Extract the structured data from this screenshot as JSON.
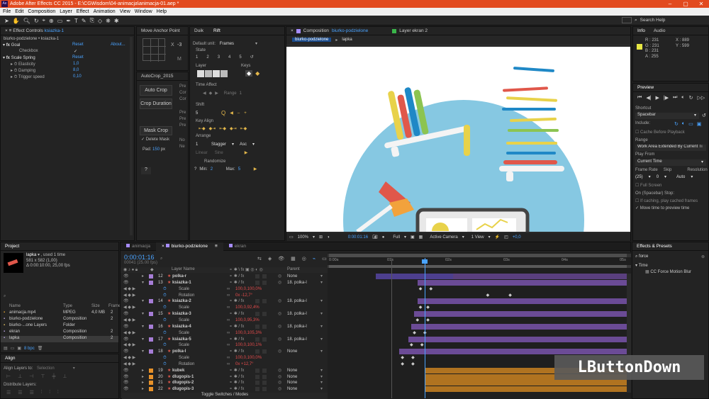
{
  "app": {
    "title": "Adobe After Effects CC 2015 - E:\\CGWisdom\\04-animacja\\animacja-01.aep *",
    "logo": "Ae"
  },
  "menu": [
    "File",
    "Edit",
    "Composition",
    "Layer",
    "Effect",
    "Animation",
    "View",
    "Window",
    "Help"
  ],
  "search_help": "Search Help",
  "effect_controls": {
    "tab": "Effect Controls",
    "target": "ksiazka-1",
    "breadcrumb": "biurko-podzielone • ksiazka-1",
    "goal": "Goal",
    "reset": "Reset",
    "about": "About...",
    "checkbox": "Checkbox",
    "scale_spring": "Scale Spring",
    "reset2": "Reset",
    "elasticity": "Elasticity",
    "elasticity_val": "1,0",
    "damping": "Damping",
    "damping_val": "8,0",
    "trigger": "Trigger speed",
    "trigger_val": "0,10"
  },
  "anchor_panel": {
    "title": "Move Anchor Point",
    "x": "X",
    "x_val": "-3",
    "m": "M"
  },
  "autocrop": {
    "title": "AutoCrop_2015",
    "auto_crop": "Auto Crop",
    "crop_duration": "Crop Duration",
    "mask_crop": "Mask Crop",
    "delete_mask": "Delete Mask",
    "pad_label": "Pad:",
    "pad_val": "150",
    "pad_unit": "px",
    "help": "?",
    "side_labels": [
      "Pre",
      "Cor",
      "Cor",
      "Pre",
      "Pre",
      "Pre",
      "No",
      "Ne"
    ]
  },
  "rift": {
    "tabs": [
      "Duik",
      "Rift"
    ],
    "default_unit_label": "Default unit:",
    "default_unit": "Frames",
    "state": "State",
    "state_nums": [
      "1",
      "2",
      "3",
      "4",
      "5"
    ],
    "layer": "Layer",
    "keys": "Keys",
    "time_affect": "Time Affect",
    "range_label": "Range",
    "range_val": "1",
    "shift": "Shift",
    "shift_val": "5",
    "key_align": "Key Align",
    "arrange": "Arrange",
    "arrange_val": "1",
    "stagger": "Stagger",
    "asc": "Asc",
    "linear": "Linear",
    "sine": "Sine",
    "randomize": "Randomize",
    "min_label": "Min:",
    "min_val": "2",
    "max_label": "Max:",
    "max_val": "5",
    "help": "?"
  },
  "composition": {
    "tab_prefix": "Composition",
    "tab_name": "biurko-podzielone",
    "layer_tab": "Layer ekran 2",
    "sub_tabs": [
      "biurko-podzielone",
      "lapka"
    ],
    "zoom": "100%",
    "time": "0:00:01:16",
    "resolution": "Full",
    "camera": "Active Camera",
    "view": "1 View",
    "exposure": "+0,0"
  },
  "info": {
    "tabs": [
      "Info",
      "Audio"
    ],
    "r": "R : 231",
    "g": "G : 231",
    "b": "B : 231",
    "a": "A : 255",
    "x": "X : 889",
    "y": "Y : 599",
    "swatch_color": "#e7e743"
  },
  "preview": {
    "title": "Preview",
    "shortcut_label": "Shortcut",
    "shortcut": "Spacebar",
    "include": "Include:",
    "cache_before": "Cache Before Playback",
    "range_label": "Range",
    "range": "Work Area Extended By Current Ti",
    "play_from_label": "Play From",
    "play_from": "Current Time",
    "frame_rate_label": "Frame Rate",
    "skip_label": "Skip",
    "res_label": "Resolution",
    "frame_rate": "(25)",
    "skip": "0",
    "res": "Auto",
    "full_screen": "Full Screen",
    "on_stop": "On (Spacebar) Stop:",
    "if_caching": "If caching, play cached frames",
    "move_time": "Move time to preview time"
  },
  "effects_presets": {
    "title": "Effects & Presets",
    "search": "force",
    "group": "Time",
    "item": "CC Force Motion Blur"
  },
  "project": {
    "title": "Project",
    "item_name": "lapka",
    "used": ", used 1 time",
    "dims": "581 x 582 (1,00)",
    "duration": "Δ 0:00:10:00, 25,00 fps",
    "columns": [
      "Name",
      "Type",
      "Size",
      "Frame"
    ],
    "rows": [
      {
        "name": "animacja.mp4",
        "type": "MPEG",
        "size": "4,0 MB",
        "fr": "2",
        "color": "#e0a030"
      },
      {
        "name": "biurko-podzielone",
        "type": "Composition",
        "size": "",
        "fr": "2",
        "color": "#b9a4e0"
      },
      {
        "name": "biurko-...one Layers",
        "type": "Folder",
        "size": "",
        "fr": "",
        "color": "#e0c060"
      },
      {
        "name": "ekran",
        "type": "Composition",
        "size": "",
        "fr": "2",
        "color": "#b9a4e0"
      },
      {
        "name": "lapka",
        "type": "Composition",
        "size": "",
        "fr": "2",
        "color": "#b9a4e0"
      }
    ],
    "bpc": "8 bpc"
  },
  "align": {
    "title": "Align",
    "align_to_label": "Align Layers to:",
    "align_to": "Selection",
    "distribute": "Distribute Layers:"
  },
  "timeline": {
    "tabs": [
      "animacja",
      "biurko-podzielone",
      "ekran"
    ],
    "timecode": "0:00:01:16",
    "fps_info": "00041 (25.00 fps)",
    "col_layer_name": "Layer Name",
    "col_parent": "Parent",
    "toggle": "Toggle Switches / Modes",
    "ruler": [
      "0:00s",
      "01s",
      "02s",
      "03s",
      "04s",
      "05s"
    ],
    "rows": [
      {
        "kind": "layer",
        "num": "12",
        "name": "polka-r",
        "parent": "None",
        "color": "#a67dd6"
      },
      {
        "kind": "layer",
        "num": "13",
        "name": "ksiazka-1",
        "parent": "18. polka-l",
        "color": "#a67dd6"
      },
      {
        "kind": "prop",
        "name": "Scale",
        "val": "100,0,100,0%"
      },
      {
        "kind": "prop",
        "name": "Rotation",
        "val": "0x -12,7°"
      },
      {
        "kind": "layer",
        "num": "14",
        "name": "ksiazka-2",
        "parent": "18. polka-l",
        "color": "#a67dd6"
      },
      {
        "kind": "prop",
        "name": "Scale",
        "val": "100,0,92,4%"
      },
      {
        "kind": "layer",
        "num": "15",
        "name": "ksiazka-3",
        "parent": "18. polka-l",
        "color": "#a67dd6"
      },
      {
        "kind": "prop",
        "name": "Scale",
        "val": "100,0,95,3%"
      },
      {
        "kind": "layer",
        "num": "16",
        "name": "ksiazka-4",
        "parent": "18. polka-l",
        "color": "#a67dd6"
      },
      {
        "kind": "prop",
        "name": "Scale",
        "val": "100,0,105,3%"
      },
      {
        "kind": "layer",
        "num": "17",
        "name": "ksiazka-5",
        "parent": "18. polka-l",
        "color": "#a67dd6"
      },
      {
        "kind": "prop",
        "name": "Scale",
        "val": "100,0,100,1%"
      },
      {
        "kind": "layer",
        "num": "18",
        "name": "polka-l",
        "parent": "None",
        "color": "#a67dd6"
      },
      {
        "kind": "prop",
        "name": "Scale",
        "val": "100,0,100,0%"
      },
      {
        "kind": "prop",
        "name": "Rotation",
        "val": "0x +12,7°"
      },
      {
        "kind": "layer",
        "num": "19",
        "name": "kubek",
        "parent": "None",
        "color": "#e8922a"
      },
      {
        "kind": "layer",
        "num": "20",
        "name": "dlugopis-1",
        "parent": "None",
        "color": "#e8922a"
      },
      {
        "kind": "layer",
        "num": "21",
        "name": "dlugopis-2",
        "parent": "None",
        "color": "#e8922a"
      },
      {
        "kind": "layer",
        "num": "22",
        "name": "dlugopis-3",
        "parent": "None",
        "color": "#e8922a"
      }
    ]
  },
  "overlay": "LButtonDown"
}
